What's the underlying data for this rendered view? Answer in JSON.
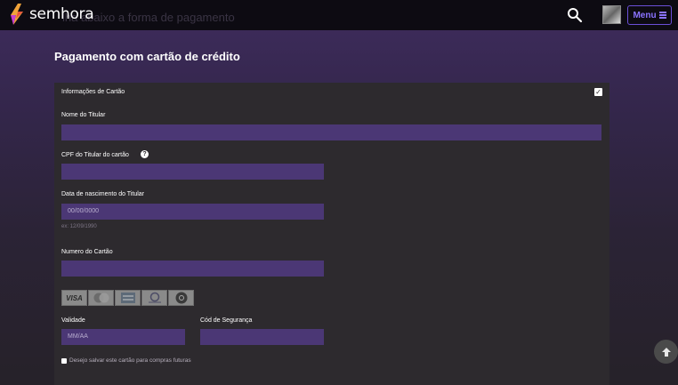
{
  "header": {
    "ghost_text": "lha abaixo a forma de pagamento",
    "logo_text": "semhora",
    "menu_label": "Menu"
  },
  "page": {
    "title": "Pagamento com cartão de crédito"
  },
  "card_form": {
    "section_title": "Informações de Cartão",
    "holder_name_label": "Nome do Titular",
    "holder_name_value": "",
    "cpf_label": "CPF do Titular do cartão",
    "cpf_value": "",
    "birth_label": "Data de nascimento do Titular",
    "birth_placeholder": "00/00/0000",
    "birth_hint": "ex: 12/09/1990",
    "number_label": "Numero do Cartão",
    "number_value": "",
    "brands": [
      "visa",
      "mastercard",
      "amex",
      "diners",
      "elo"
    ],
    "brand_visa_text": "VISA",
    "validity_label": "Validade",
    "validity_placeholder": "MM/AA",
    "cvv_label": "Cód de Segurança",
    "cvv_value": "",
    "save_card_label": "Desejo salvar este cartão para compras futuras"
  },
  "icons": {
    "search": "search-icon",
    "scroll_top": "arrow-up-icon",
    "help": "question-icon"
  },
  "colors": {
    "input_bg": "#4b3775",
    "menu_accent": "#8a73ff",
    "card_bg": "#2d2a2e"
  }
}
